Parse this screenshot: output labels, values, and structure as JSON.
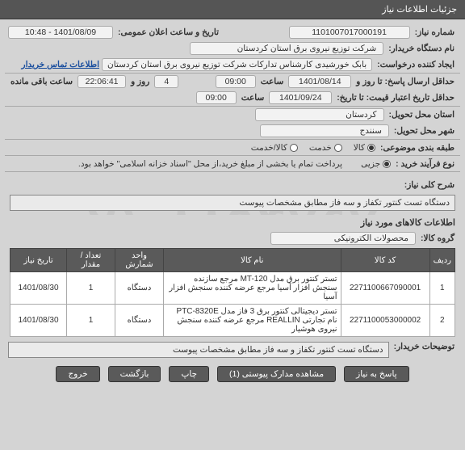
{
  "watermark": "۰۲۱-۸۸۹۴۷۶۷۰",
  "header": {
    "title": "جزئیات اطلاعات نیاز"
  },
  "labels": {
    "need_no": "شماره نیاز:",
    "announce_dt": "تاریخ و ساعت اعلان عمومی:",
    "buyer_org": "نام دستگاه خریدار:",
    "requester": "ایجاد کننده درخواست:",
    "send_deadline": "حداقل ارسال پاسخ: تا روز و",
    "remaining": "ساعت باقی مانده",
    "valid_deadline": "حداقل تاریخ اعتبار قیمت: تا تاریخ:",
    "work_province": "استان محل تحویل:",
    "work_city": "شهر محل تحویل:",
    "category": "طبقه بندی موضوعی:",
    "purchase_type": "نوع فرآیند خرید :",
    "saat": "ساعت",
    "general_desc": "شرح کلی نیاز:",
    "items_section": "اطلاعات کالاهای مورد نیاز",
    "product_group": "گروه کالا:",
    "buyer_notes": "توضیحات خریدار:"
  },
  "fields": {
    "need_no": "1101007017000191",
    "announce_dt": "1401/08/09 - 10:48",
    "buyer_org": "شرکت توزیع نیروی برق استان کردستان",
    "requester": "بابک خورشیدی کارشناس تدارکات شرکت توزیع نیروی برق استان کردستان",
    "contact_link": "اطلاعات تماس خریدار",
    "deadline_date": "1401/08/14",
    "deadline_time": "09:00",
    "days_left": "4",
    "time_left": "22:06:41",
    "valid_date": "1401/09/24",
    "valid_time": "09:00",
    "province": "کردستان",
    "city": "سنندج",
    "general_desc": "دستگاه تست کنتور تکفاز و سه فاز مطابق مشخصات پیوست",
    "product_group": "محصولات الکترونیکی",
    "buyer_notes": "دستگاه تست کنتور تکفاز و سه فاز مطابق مشخصات پیوست"
  },
  "categories": {
    "opt1": "کالا",
    "opt2": "خدمت",
    "opt3": "کالا/خدمت",
    "selected": 0
  },
  "purchase": {
    "opt1": "جزیی",
    "note": "پرداخت تمام یا بخشی از مبلغ خرید،از محل \"اسناد خزانه اسلامی\" خواهد بود."
  },
  "table": {
    "headers": [
      "ردیف",
      "کد کالا",
      "نام کالا",
      "واحد شمارش",
      "تعداد / مقدار",
      "تاریخ نیاز"
    ],
    "rows": [
      {
        "idx": "1",
        "code": "2271100667090001",
        "name": "تستر کنتور برق مدل MT-120 مرجع سازنده سنجش افزار آسیا مرجع عرضه کننده سنجش افزار آسیا",
        "unit": "دستگاه",
        "qty": "1",
        "date": "1401/08/30"
      },
      {
        "idx": "2",
        "code": "2271100053000002",
        "name": "تستر دیجیتالی کنتور برق 3 فاز مدل PTC-8320E نام تجارتی REALLIN مرجع عرضه کننده سنجش نیروی هوشیار",
        "unit": "دستگاه",
        "qty": "1",
        "date": "1401/08/30"
      }
    ]
  },
  "buttons": {
    "reply": "پاسخ به نیاز",
    "attachments": "مشاهده مدارک پیوستی (1)",
    "print": "چاپ",
    "back": "بازگشت",
    "exit": "خروج"
  }
}
